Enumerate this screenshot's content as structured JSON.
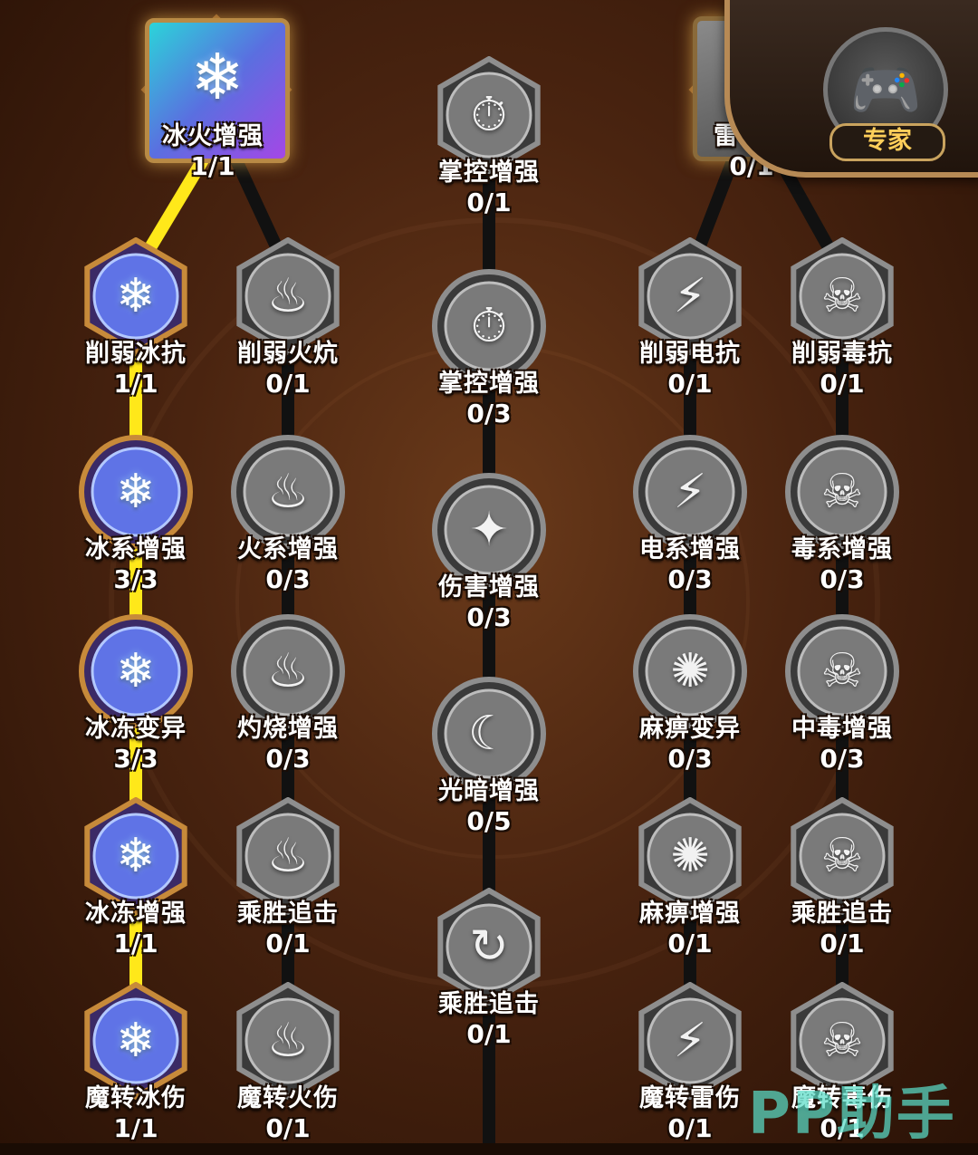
{
  "badge": {
    "label": "专家",
    "icon": "gamepad-icon"
  },
  "watermark": "PP助手",
  "colors": {
    "active_line": "#ffe81a",
    "inactive_line": "#111111",
    "active_border": "#c78a3a",
    "inactive_border": "#8e8e8e"
  },
  "top": {
    "fire_ice": {
      "label": "冰火增强",
      "count": "1/1",
      "icon": "ice-fire-icon"
    },
    "thunder_poison": {
      "label": "雷毒增",
      "count": "0/1",
      "icon": "thunder-skull-icon"
    }
  },
  "center": [
    {
      "label": "掌控增强",
      "count": "0/1",
      "icon": "stopwatch-icon"
    },
    {
      "label": "掌控增强",
      "count": "0/3",
      "icon": "stopwatch-icon"
    },
    {
      "label": "伤害增强",
      "count": "0/3",
      "icon": "damage-spike-icon"
    },
    {
      "label": "光暗增强",
      "count": "0/5",
      "icon": "moon-star-icon"
    },
    {
      "label": "乘胜追击",
      "count": "0/1",
      "icon": "pursuit-icon"
    }
  ],
  "col_ice": [
    {
      "label": "削弱冰抗",
      "count": "1/1",
      "icon": "snowflake-icon"
    },
    {
      "label": "冰系增强",
      "count": "3/3",
      "icon": "snowflake-icon"
    },
    {
      "label": "冰冻变异",
      "count": "3/3",
      "icon": "snowflake-icon"
    },
    {
      "label": "冰冻增强",
      "count": "1/1",
      "icon": "snowflake-icon"
    },
    {
      "label": "魔转冰伤",
      "count": "1/1",
      "icon": "snowflake-icon"
    }
  ],
  "col_fire": [
    {
      "label": "削弱火炕",
      "count": "0/1",
      "icon": "flame-icon"
    },
    {
      "label": "火系增强",
      "count": "0/3",
      "icon": "flame-icon"
    },
    {
      "label": "灼烧增强",
      "count": "0/3",
      "icon": "flame-icon"
    },
    {
      "label": "乘胜追击",
      "count": "0/1",
      "icon": "flame-icon"
    },
    {
      "label": "魔转火伤",
      "count": "0/1",
      "icon": "flame-icon"
    }
  ],
  "col_thunder": [
    {
      "label": "削弱电抗",
      "count": "0/1",
      "icon": "lightning-icon"
    },
    {
      "label": "电系增强",
      "count": "0/3",
      "icon": "lightning-icon"
    },
    {
      "label": "麻痹变异",
      "count": "0/3",
      "icon": "swirl-icon"
    },
    {
      "label": "麻痹增强",
      "count": "0/1",
      "icon": "swirl-icon"
    },
    {
      "label": "魔转雷伤",
      "count": "0/1",
      "icon": "lightning-icon"
    }
  ],
  "col_poison": [
    {
      "label": "削弱毒抗",
      "count": "0/1",
      "icon": "skull-icon"
    },
    {
      "label": "毒系增强",
      "count": "0/3",
      "icon": "skull-icon"
    },
    {
      "label": "中毒增强",
      "count": "0/3",
      "icon": "skull-icon"
    },
    {
      "label": "乘胜追击",
      "count": "0/1",
      "icon": "skull-icon"
    },
    {
      "label": "魔转毒伤",
      "count": "0/1",
      "icon": "skull-icon"
    }
  ]
}
